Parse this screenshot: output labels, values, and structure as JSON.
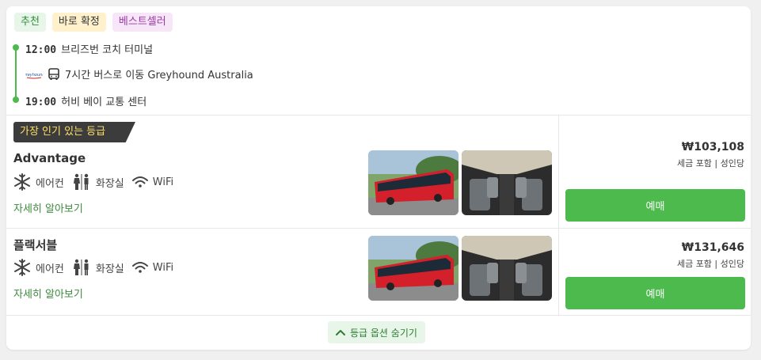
{
  "tags": [
    {
      "label": "추천",
      "style": "green"
    },
    {
      "label": "바로 확정",
      "style": "yellow"
    },
    {
      "label": "베스트셀러",
      "style": "purple"
    }
  ],
  "route": {
    "departure_time": "12:00",
    "departure_place": "브리즈번 코치 터미널",
    "arrival_time": "19:00",
    "arrival_place": "허비 베이 교통 센터",
    "transfer_text": "7시간 버스로 이동 Greyhound Australia",
    "operator_logo_text": "greyhound"
  },
  "popular_badge": "가장 인기 있는 등급",
  "classes": [
    {
      "name": "Advantage",
      "amenities": {
        "aircon": "에어컨",
        "toilet": "화장실",
        "wifi": "WiFi"
      },
      "more": "자세히 알아보기",
      "price": "₩103,108",
      "price_note": "세금 포함 | 성인당",
      "book": "예매"
    },
    {
      "name": "플랙서블",
      "amenities": {
        "aircon": "에어컨",
        "toilet": "화장실",
        "wifi": "WiFi"
      },
      "more": "자세히 알아보기",
      "price": "₩131,646",
      "price_note": "세금 포함 | 성인당",
      "book": "예매"
    }
  ],
  "collapse_label": "등급 옵션 숨기기",
  "colors": {
    "accent": "#4cba4c",
    "link": "#3c8a3c",
    "badge_bg": "#3c3c3c",
    "badge_text": "#ffe066"
  }
}
